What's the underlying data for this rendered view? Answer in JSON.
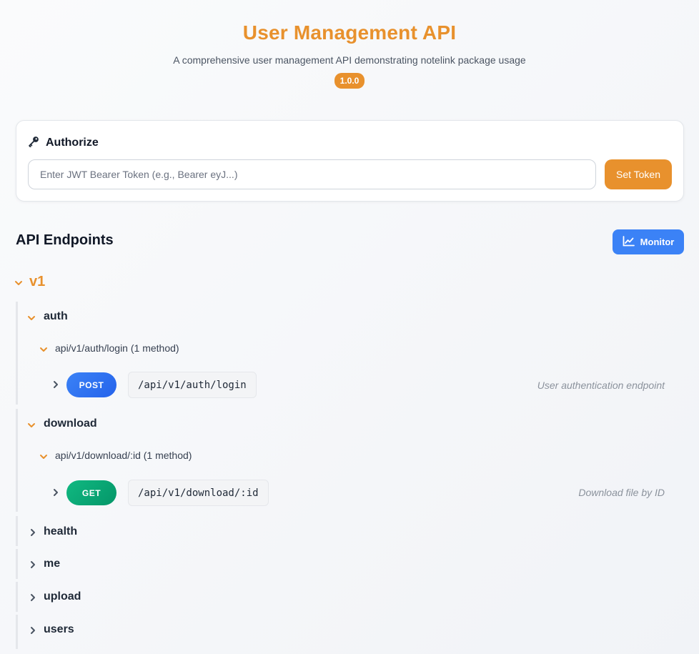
{
  "header": {
    "title": "User Management API",
    "subtitle": "A comprehensive user management API demonstrating notelink package usage",
    "version": "1.0.0"
  },
  "auth": {
    "icon": "key-icon",
    "title": "Authorize",
    "placeholder": "Enter JWT Bearer Token (e.g., Bearer eyJ...)",
    "value": "",
    "button_label": "Set Token"
  },
  "endpoints": {
    "section_title": "API Endpoints",
    "monitor_label": "Monitor",
    "monitor_icon": "chart-line-icon",
    "version_label": "v1",
    "groups": [
      {
        "name": "auth",
        "expanded": true,
        "path_label": "api/v1/auth/login (1 method)",
        "method": "POST",
        "route": "/api/v1/auth/login",
        "description": "User authentication endpoint"
      },
      {
        "name": "download",
        "expanded": true,
        "path_label": "api/v1/download/:id (1 method)",
        "method": "GET",
        "route": "/api/v1/download/:id",
        "description": "Download file by ID"
      },
      {
        "name": "health",
        "expanded": false
      },
      {
        "name": "me",
        "expanded": false
      },
      {
        "name": "upload",
        "expanded": false
      },
      {
        "name": "users",
        "expanded": false
      }
    ]
  },
  "colors": {
    "accent": "#e8912d",
    "primary": "#3b82f6",
    "post": "#2563eb",
    "get": "#059669"
  }
}
